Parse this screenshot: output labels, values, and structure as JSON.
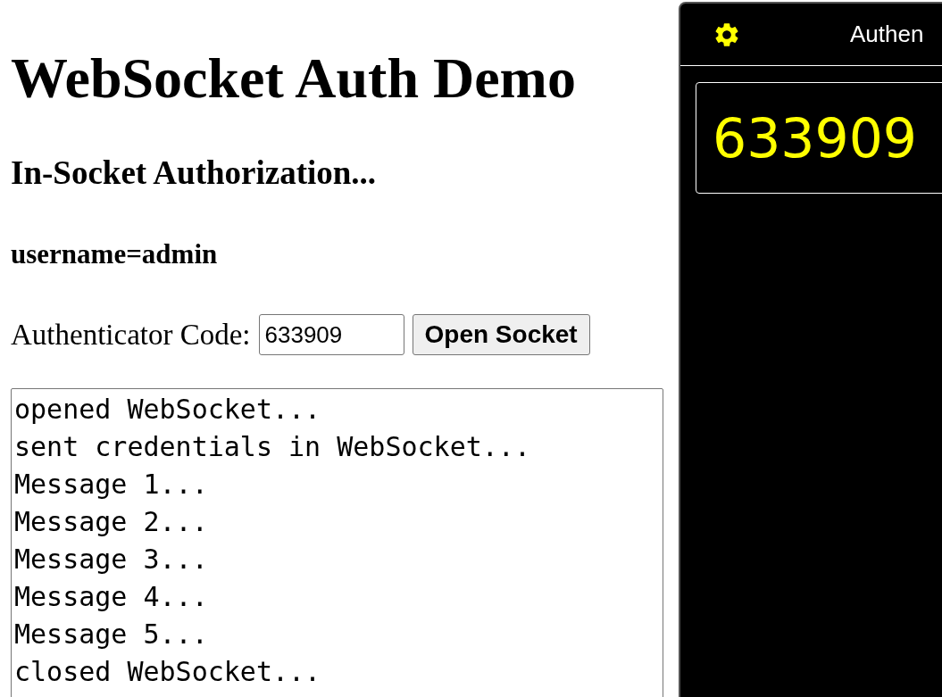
{
  "page": {
    "title": "WebSocket Auth Demo",
    "subtitle": "In-Socket Authorization...",
    "user": "username=admin",
    "code_label": "Authenticator Code:",
    "code_value": "633909",
    "button": "Open Socket",
    "log": [
      "opened WebSocket...",
      "sent credentials in WebSocket...",
      "Message 1...",
      "Message 2...",
      "Message 3...",
      "Message 4...",
      "Message 5...",
      "closed WebSocket..."
    ]
  },
  "authenticator": {
    "title": "Authen",
    "code": "633909"
  }
}
